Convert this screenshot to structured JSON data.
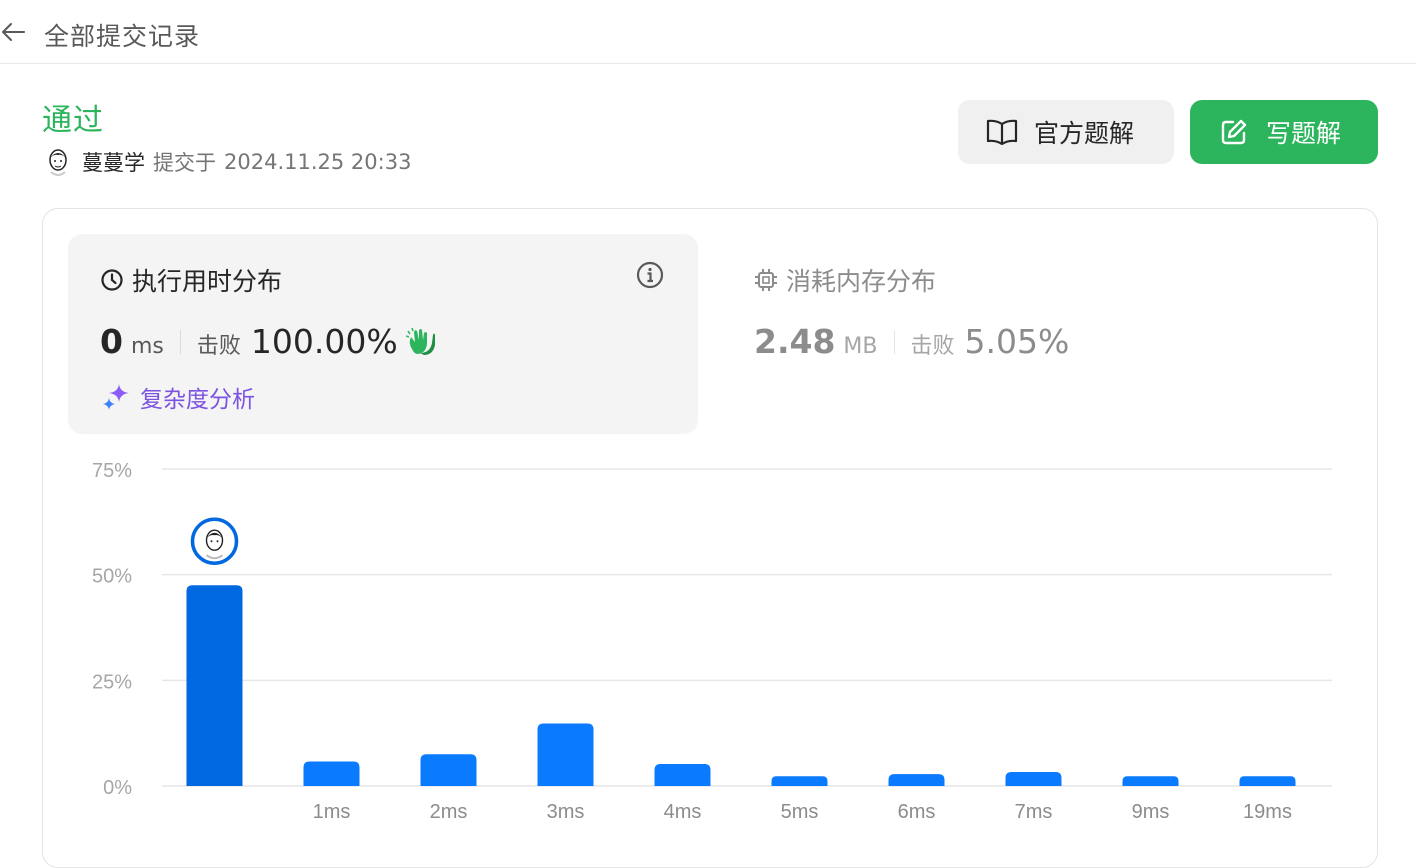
{
  "topbar": {
    "back_icon": "arrow-left-icon",
    "title": "全部提交记录"
  },
  "submission": {
    "status": "通过",
    "status_color": "#2db55d",
    "username": "蔓蔓学",
    "submit_label": "提交于",
    "submit_time": "2024.11.25 20:33"
  },
  "actions": {
    "official_solution_label": "官方题解",
    "official_solution_icon": "book-open-icon",
    "write_solution_label": "写题解",
    "write_solution_icon": "edit-icon",
    "write_color": "#2db55d"
  },
  "runtime": {
    "title": "执行用时分布",
    "icon": "clock-icon",
    "info_icon": "info-icon",
    "value": "0",
    "unit": "ms",
    "beats_label": "击败",
    "beats_value": "100.00%",
    "beats_icon": "clap-hands-icon",
    "complexity_label": "复杂度分析",
    "complexity_icon": "sparkle-icon"
  },
  "memory": {
    "title": "消耗内存分布",
    "icon": "chip-icon",
    "value": "2.48",
    "unit": "MB",
    "beats_label": "击败",
    "beats_value": "5.05%"
  },
  "chart_data": {
    "type": "bar",
    "categories": [
      "",
      "1ms",
      "2ms",
      "3ms",
      "4ms",
      "5ms",
      "6ms",
      "7ms",
      "9ms",
      "19ms"
    ],
    "values": [
      47.5,
      5.8,
      7.5,
      14.8,
      5.2,
      2.3,
      2.8,
      3.3,
      2.3,
      2.3
    ],
    "yticks": [
      "0%",
      "25%",
      "50%",
      "75%"
    ],
    "ylim": [
      0,
      75
    ],
    "highlight_index": 0,
    "highlight_color": "#0068e0",
    "bar_color": "#0a7aff",
    "grid": true
  }
}
